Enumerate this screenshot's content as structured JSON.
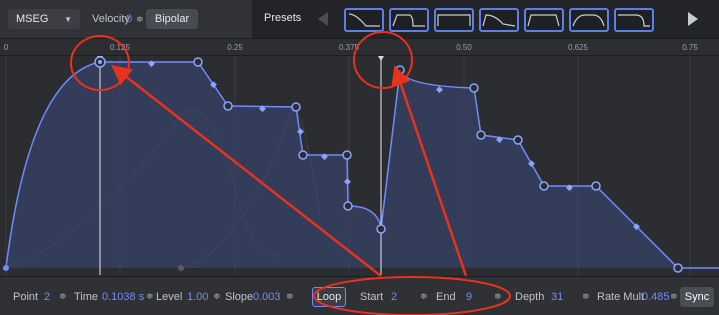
{
  "toolbar": {
    "mode_select": "MSEG",
    "velocity_label": "Velocity",
    "velocity_value": "0",
    "bipolar_label": "Bipolar",
    "presets_label": "Presets"
  },
  "ruler": {
    "ticks": [
      "0",
      "0.125",
      "0.25",
      "0.375",
      "0.50",
      "0.625",
      "0.75"
    ]
  },
  "bottom": {
    "point_label": "Point",
    "point_value": "2",
    "time_label": "Time",
    "time_value": "0.1038 s",
    "level_label": "Level",
    "level_value": "1.00",
    "slope_label": "Slope",
    "slope_value": "0.003",
    "loop_label": "Loop",
    "start_label": "Start",
    "start_value": "2",
    "end_label": "End",
    "end_value": "9",
    "depth_label": "Depth",
    "depth_value": "31",
    "rate_mult_label": "Rate Mult",
    "rate_mult_value": "0.485",
    "sync_label": "Sync"
  },
  "colors": {
    "accent": "#6f8cff",
    "annotation": "#e8321e",
    "background": "#2a2c30"
  },
  "icons": {
    "spin": "up-down-arrows-icon",
    "prev": "left-triangle-icon",
    "next": "right-triangle-icon",
    "caret": "chevron-down-icon"
  }
}
